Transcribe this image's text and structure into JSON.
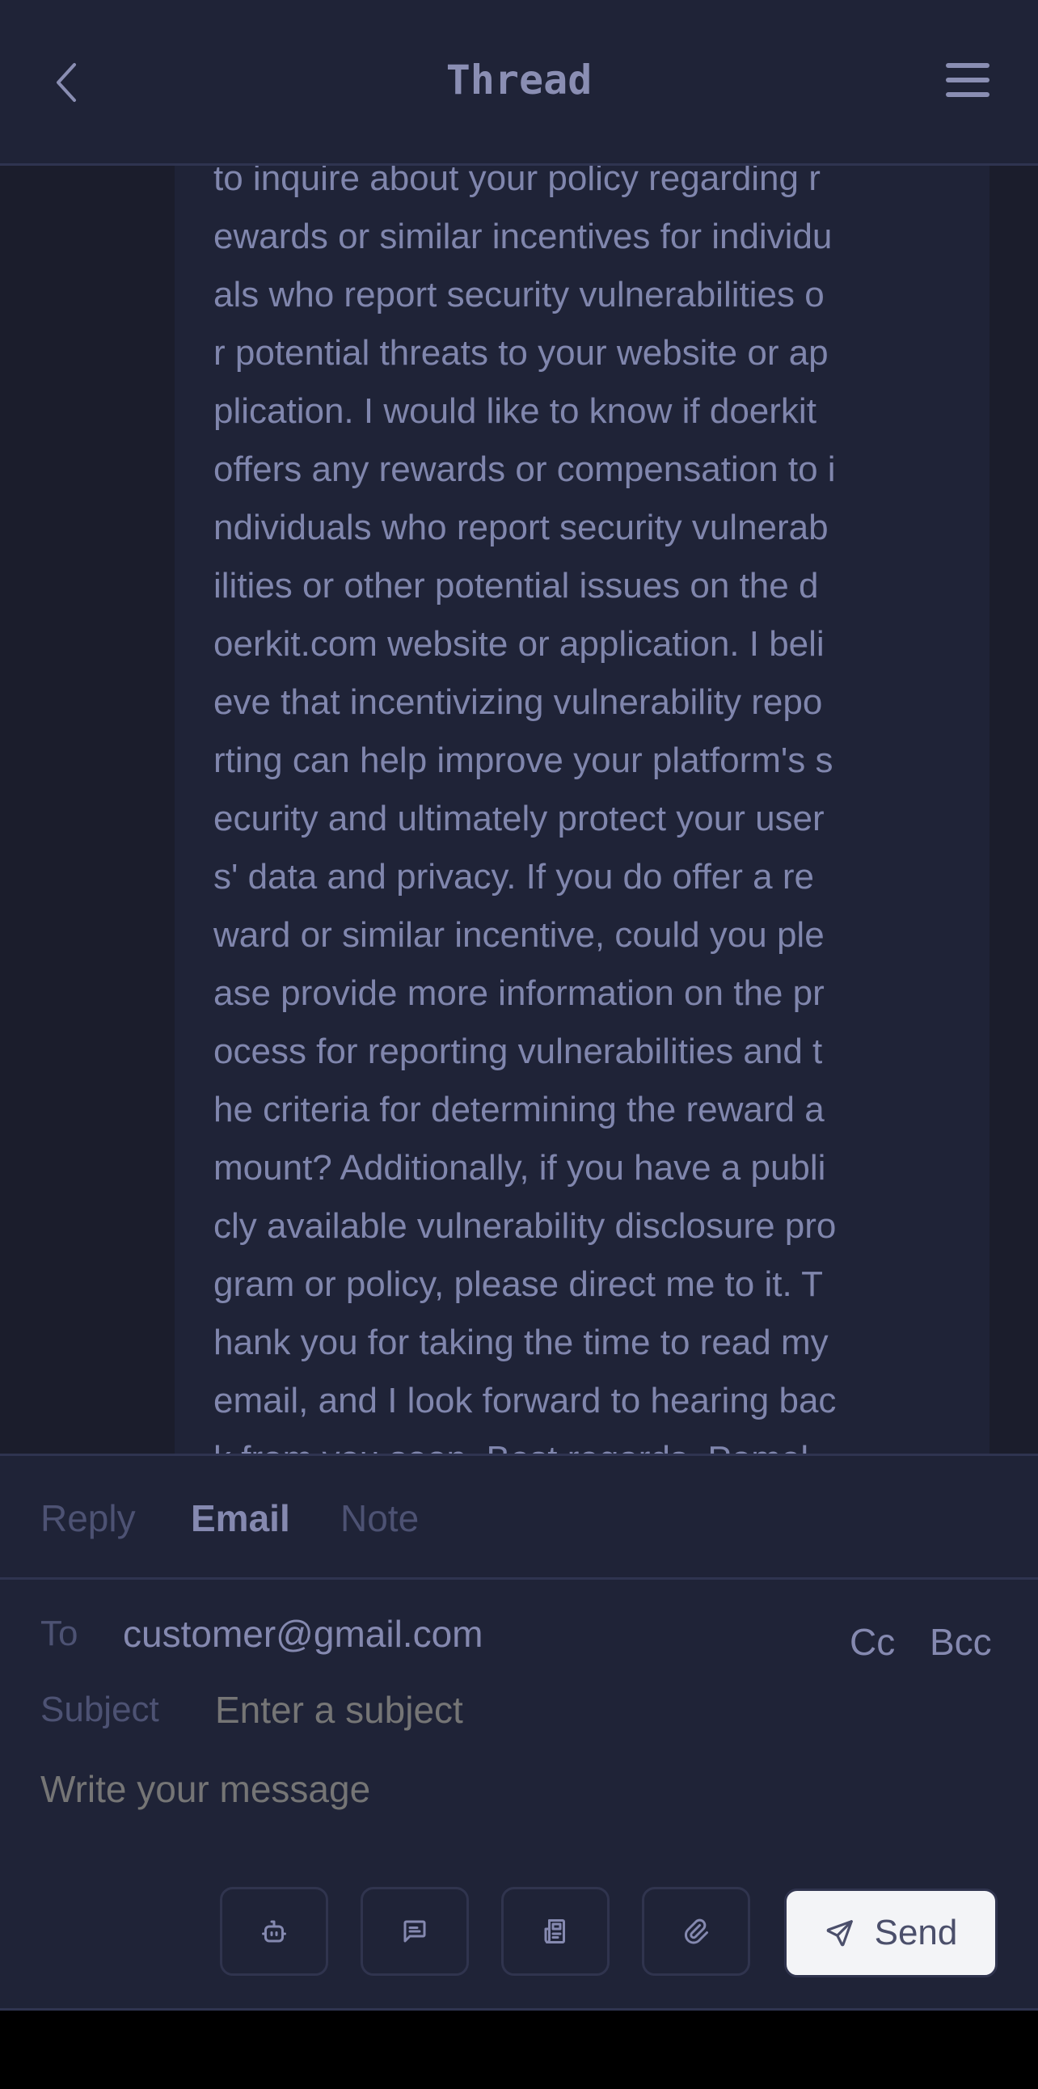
{
  "header": {
    "title": "Thread",
    "back_icon": "chevron-left-icon",
    "menu_icon": "hamburger-menu-icon"
  },
  "message": {
    "lines": [
      "to inquire about your policy regarding r",
      "ewards or similar incentives for individu",
      "als who report security vulnerabilities o",
      "r potential threats to your website or ap",
      "plication. I would like to know if doerkit",
      "offers any rewards or compensation to i",
      "ndividuals who report security vulnerab",
      "ilities or other potential issues on the d",
      "oerkit.com website or application. I beli",
      "eve that incentivizing vulnerability repo",
      "rting can help improve your platform's s",
      "ecurity and ultimately protect your user",
      "s' data and privacy. If you do offer a re",
      "ward or similar incentive, could you ple",
      "ase provide more information on the pr",
      "ocess for reporting vulnerabilities and t",
      "he criteria for determining the reward a",
      "mount? Additionally, if you have a publi",
      "cly available vulnerability disclosure pro",
      "gram or policy, please direct me to it. T",
      "hank you for taking the time to read my",
      "email, and I look forward to hearing bac",
      "k from you soon. Best regards, Pomel"
    ]
  },
  "compose": {
    "tabs": [
      {
        "label": "Reply",
        "active": false
      },
      {
        "label": "Email",
        "active": true
      },
      {
        "label": "Note",
        "active": false
      }
    ],
    "to_label": "To",
    "to_value": "customer@gmail.com",
    "cc_label": "Cc",
    "bcc_label": "Bcc",
    "subject_label": "Subject",
    "subject_value": "",
    "subject_placeholder": "Enter a subject",
    "message_placeholder": "Write your message",
    "toolbar": [
      {
        "icon": "robot-icon",
        "label": "AI assistant"
      },
      {
        "icon": "message-icon",
        "label": "Canned response"
      },
      {
        "icon": "newspaper-icon",
        "label": "Article"
      },
      {
        "icon": "paperclip-icon",
        "label": "Attach"
      }
    ],
    "send_label": "Send",
    "send_icon": "send-icon"
  },
  "colors": {
    "background": "#1f2337",
    "thread_background": "#1b1d2c",
    "text": "#8086ad",
    "muted": "#4d5273",
    "border": "#2f3450",
    "send_button": "#f3f4f7"
  }
}
